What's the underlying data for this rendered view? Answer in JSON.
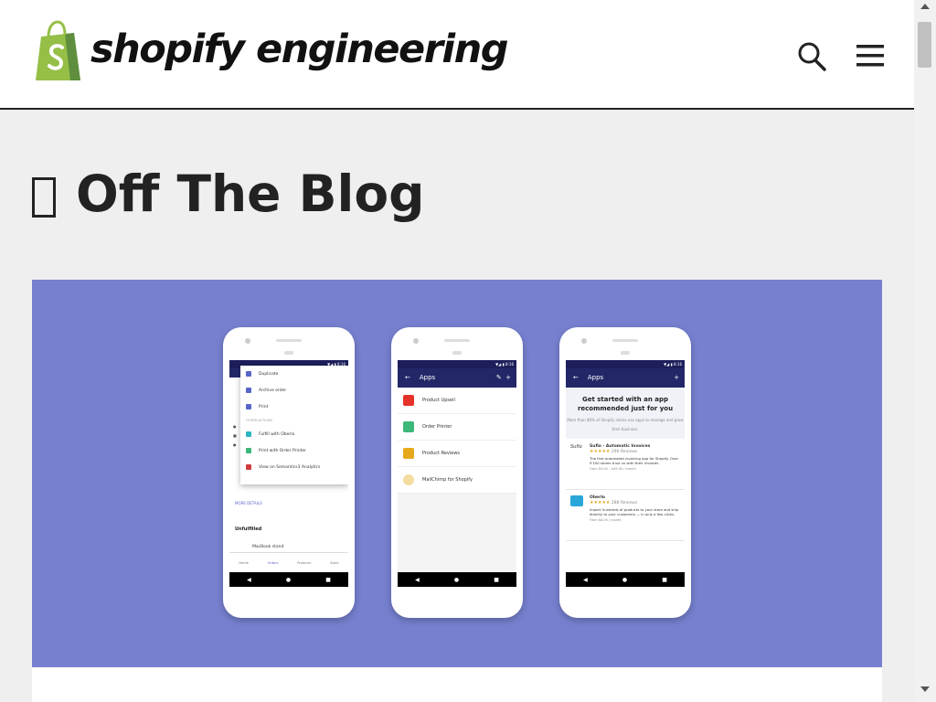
{
  "header": {
    "brand_name": "shopify engineering",
    "logo_icon": "shopify-bag-logo",
    "brand_color": "#95bf47",
    "search_icon": "search-icon",
    "menu_icon": "hamburger-menu-icon"
  },
  "page": {
    "title": "Off The Blog",
    "title_icon": "missing-glyph-box"
  },
  "hero": {
    "background_color": "#7680cf",
    "phones": [
      {
        "menu_items": [
          "Duplicate",
          "Archive order",
          "Print"
        ],
        "menu_section": "OTHER ACTIONS",
        "menu_actions": [
          "Fulfill with Oberlo",
          "Print with Order Printer",
          "View on Semantics3 Analytics"
        ],
        "more_details": "MORE DETAILS",
        "section": "Unfulfilled",
        "item": "MacBook stand",
        "tabs": [
          "Home",
          "Orders",
          "Products",
          "Store"
        ]
      },
      {
        "appbar_title": "Apps",
        "apps": [
          "Product Upsell",
          "Order Printer",
          "Product Reviews",
          "MailChimp for Shopify"
        ]
      },
      {
        "appbar_title": "Apps",
        "heading": "Get started with an app recommended just for you",
        "subheading": "More than 80% of Shopify stores use apps to manage and grow their business.",
        "cards": [
          {
            "name": "Sufio - Automatic Invoices",
            "reviews": "290 Reviews",
            "desc": "The first automated invoicing app for Shopify. Over 5'100 stores trust us with their invoices.",
            "price": "From $9.00 – $49.00 / month"
          },
          {
            "name": "Oberlo",
            "reviews": "288 Reviews",
            "desc": "Import hundreds of products to your store and ship directly to your customers — in only a few clicks.",
            "price": "From $8.00 / month"
          }
        ]
      }
    ]
  }
}
